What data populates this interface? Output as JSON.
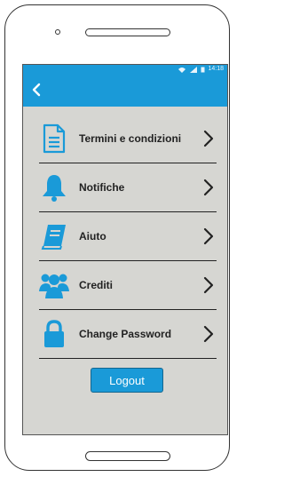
{
  "statusbar": {
    "time": "14:18"
  },
  "menu": {
    "items": [
      {
        "label": "Termini e condizioni",
        "icon": "document-icon"
      },
      {
        "label": "Notifiche",
        "icon": "bell-icon"
      },
      {
        "label": "Aiuto",
        "icon": "book-icon"
      },
      {
        "label": "Crediti",
        "icon": "people-icon"
      },
      {
        "label": "Change Password",
        "icon": "lock-icon"
      }
    ]
  },
  "logout_label": "Logout",
  "colors": {
    "accent": "#1a9ad8",
    "screen_bg": "#d6d6d2",
    "text": "#222222"
  }
}
